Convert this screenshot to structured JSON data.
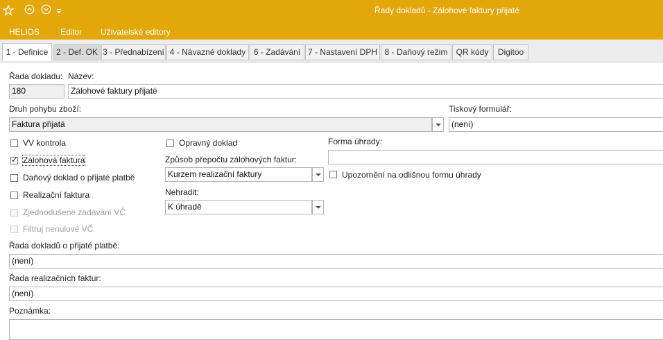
{
  "window": {
    "title": "Řady dokladů - Zálohové faktury přijaté",
    "accent_color": "#e3a70a"
  },
  "quick_access": {
    "icons": [
      "star-icon",
      "chevron-up-circle-icon",
      "chevron-down-circle-icon",
      "customize-dropdown-icon"
    ]
  },
  "menu": {
    "items": [
      "HELIOS",
      "Editor",
      "Uživatelské editory"
    ]
  },
  "tabs": [
    {
      "label": "1 - Definice",
      "active": true
    },
    {
      "label": "2 - Def. OK"
    },
    {
      "label": "3 - Přednabízení"
    },
    {
      "label": "4 - Návazné doklady"
    },
    {
      "label": "6 - Zadávání"
    },
    {
      "label": "7 - Nastavení DPH"
    },
    {
      "label": "8 - Daňový režim"
    },
    {
      "label": "QR kódy"
    },
    {
      "label": "Digitoo"
    }
  ],
  "form": {
    "rada_label": "Řada dokladu:",
    "rada_value": "180",
    "nazev_label": "Název:",
    "nazev_value": "Zálohové faktury přijaté",
    "druh_label": "Druh pohybu zboží:",
    "druh_value": "Faktura přijatá",
    "tiskovy_label": "Tiskový formulář:",
    "tiskovy_value": "(není)",
    "vv_kontrola": {
      "label": "VV kontrola",
      "checked": false
    },
    "zalohova": {
      "label": "Zálohová faktura",
      "checked": true
    },
    "danovy_doklad": {
      "label": "Daňový doklad o přijaté platbě",
      "checked": false
    },
    "realizacni": {
      "label": "Realizační faktura",
      "checked": false
    },
    "zjednodusene": {
      "label": "Zjednodušené zadávání VČ",
      "checked": false,
      "disabled": true
    },
    "filtruj": {
      "label": "Filtruj nenulové VČ",
      "checked": false,
      "disabled": true
    },
    "opravny": {
      "label": "Opravný doklad",
      "checked": false
    },
    "zpusob_label": "Způsob přepočtu zálohových faktur:",
    "zpusob_value": "Kurzem realizační faktury",
    "nehradit_label": "Nehradit:",
    "nehradit_value": "K úhradě",
    "forma_label": "Forma úhrady:",
    "forma_value": "",
    "upozorneni": {
      "label": "Upozornění na odlišnou formu úhrady",
      "checked": false
    },
    "rada_platbe_label": "Řada dokladů o přijaté platbě:",
    "rada_platbe_value": "(není)",
    "rada_realizacnich_label": "Řada realizačních faktur:",
    "rada_realizacnich_value": "(není)",
    "poznamka_label": "Poznámka:",
    "poznamka_value": ""
  }
}
